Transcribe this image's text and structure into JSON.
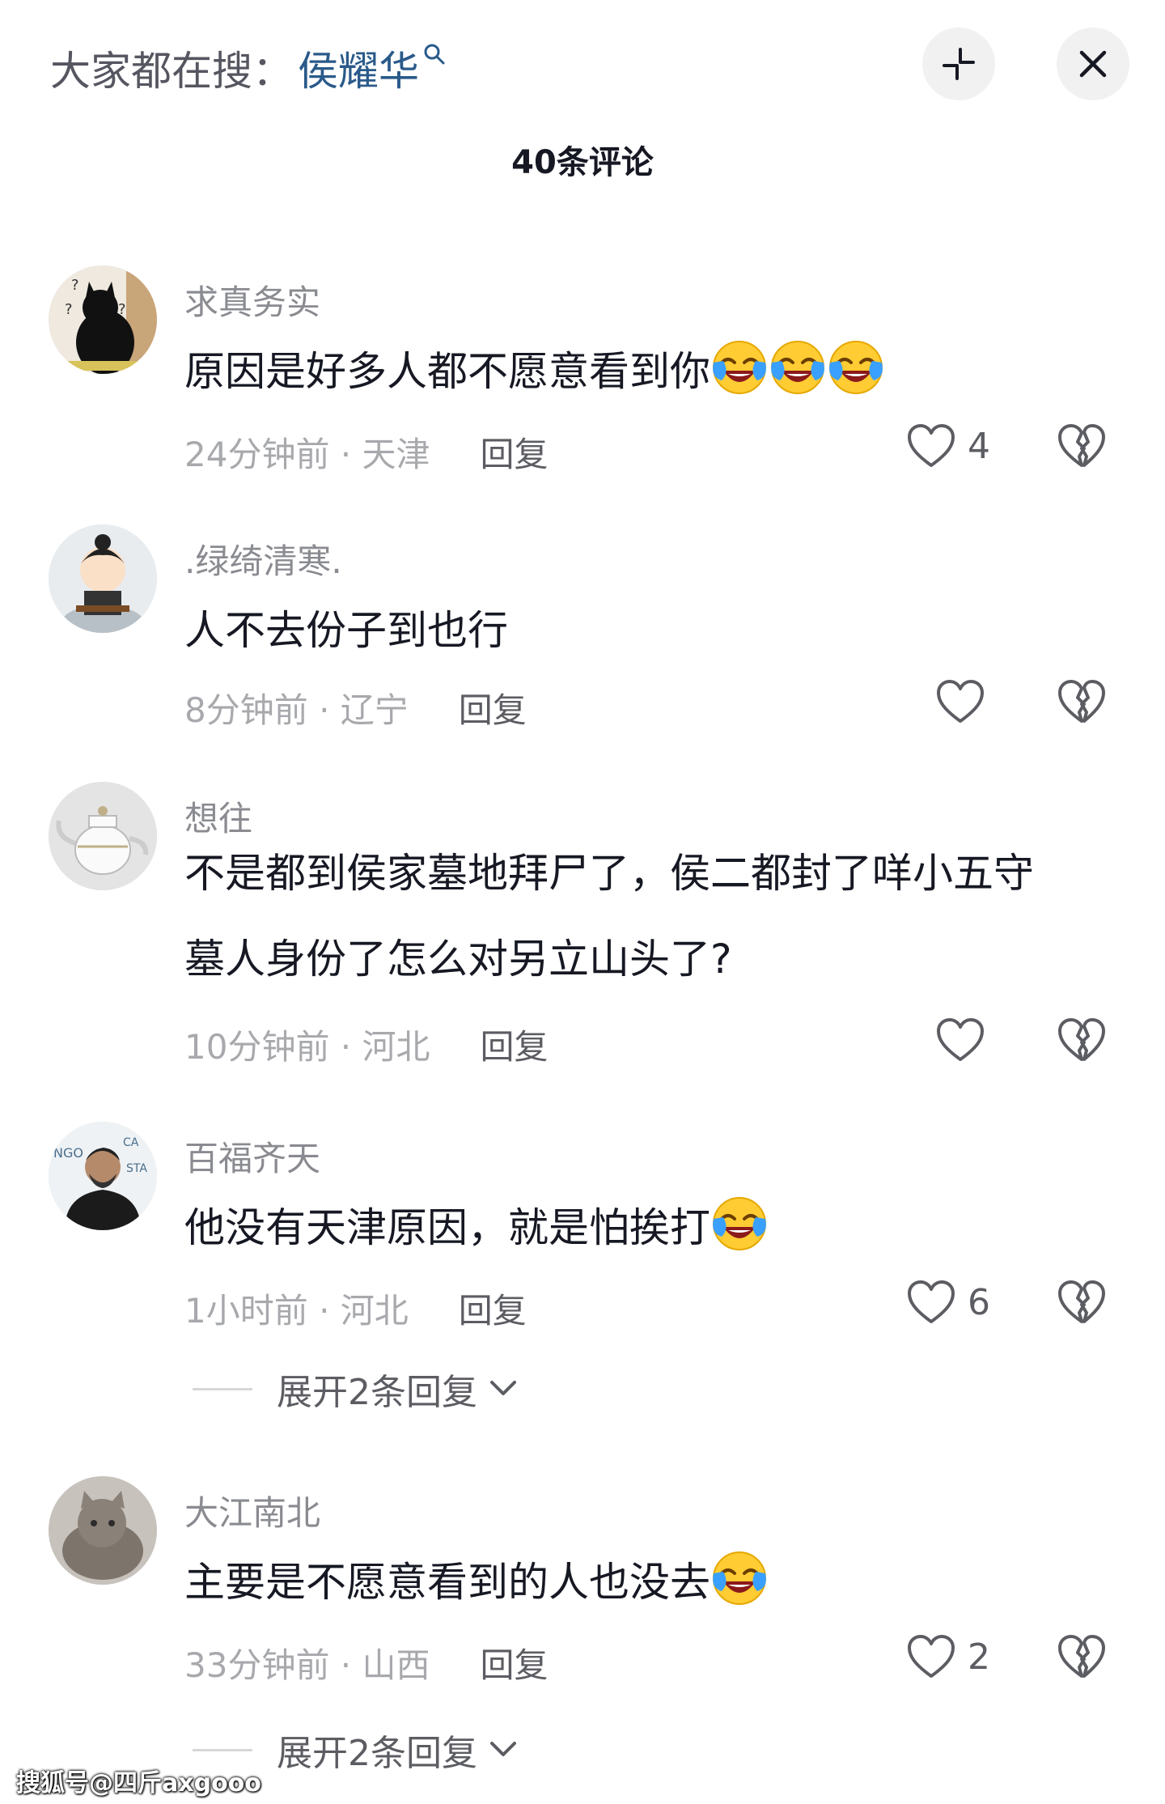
{
  "header": {
    "search_prefix": "大家都在搜：",
    "search_term": "侯耀华",
    "comment_count": "40条评论"
  },
  "icons": {
    "search": "search-icon",
    "collapse": "collapse-icon",
    "close": "close-icon",
    "like": "heart-icon",
    "dislike": "broken-heart-icon",
    "emoji": "laugh-cry-emoji"
  },
  "comments": [
    {
      "username": "求真务实",
      "text": "原因是好多人都不愿意看到你",
      "emoji_count": 3,
      "time_location": "24分钟前 · 天津",
      "reply_label": "回复",
      "likes": "4"
    },
    {
      "username": ".绿绮清寒.",
      "text": "人不去份子到也行",
      "emoji_count": 0,
      "time_location": "8分钟前 · 辽宁",
      "reply_label": "回复",
      "likes": ""
    },
    {
      "username": "想往",
      "text_line1": "不是都到侯家墓地拜尸了，侯二都封了咩小五守",
      "text_line2": "墓人身份了怎么对另立山头了?",
      "emoji_count": 0,
      "time_location": "10分钟前 · 河北",
      "reply_label": "回复",
      "likes": ""
    },
    {
      "username": "百福齐天",
      "text": "他没有天津原因，就是怕挨打",
      "emoji_count": 1,
      "time_location": "1小时前 · 河北",
      "reply_label": "回复",
      "likes": "6",
      "expand_label": "展开2条回复"
    },
    {
      "username": "大江南北",
      "text": "主要是不愿意看到的人也没去",
      "emoji_count": 1,
      "time_location": "33分钟前 · 山西",
      "reply_label": "回复",
      "likes": "2",
      "expand_label": "展开2条回复"
    }
  ],
  "watermark": "搜狐号@四斤axgooo"
}
